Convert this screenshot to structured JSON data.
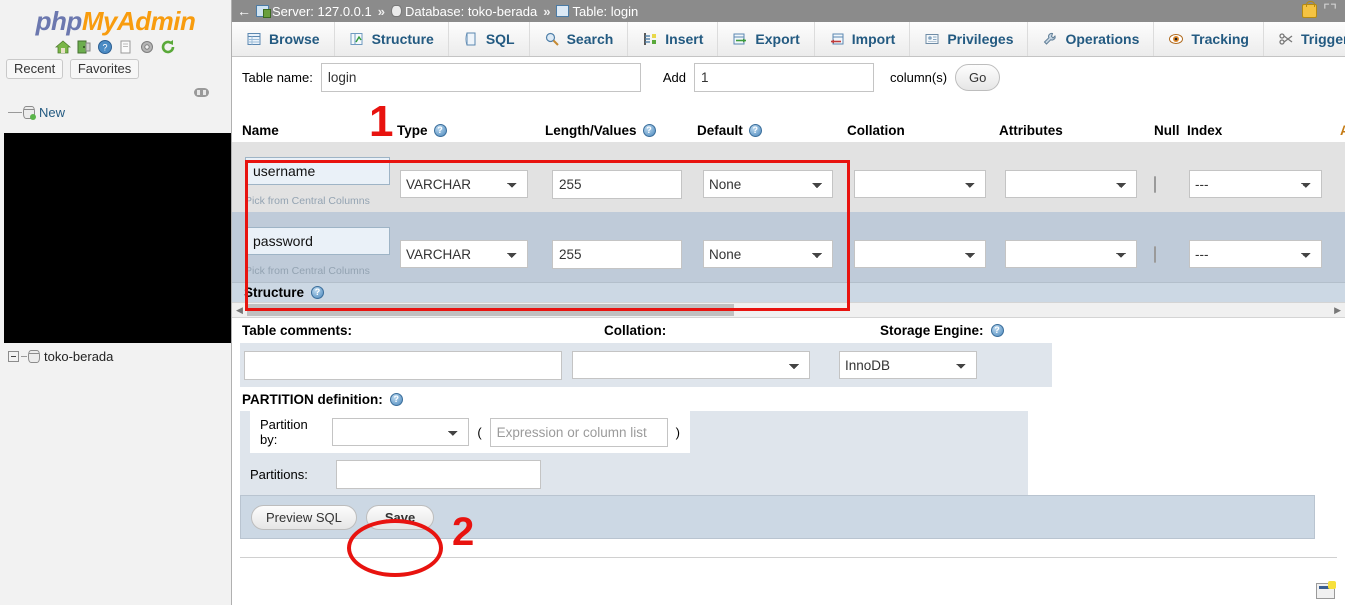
{
  "sidebar": {
    "logo": {
      "php": "php",
      "myadmin": "MyAdmin"
    },
    "logo_icons": [
      "home-icon",
      "logout-icon",
      "help-icon",
      "docs-icon",
      "settings-icon",
      "reload-icon"
    ],
    "nav_buttons": [
      {
        "label": "Recent",
        "name": "recent-button"
      },
      {
        "label": "Favorites",
        "name": "favorites-button"
      }
    ],
    "tree": {
      "new_label": "New",
      "database_label": "toko-berada"
    }
  },
  "topbar": {
    "back": "←",
    "breadcrumbs": [
      {
        "icon": "server-icon",
        "label": "Server: 127.0.0.1"
      },
      {
        "icon": "database-icon",
        "label": "Database: toko-berada"
      },
      {
        "icon": "table-icon",
        "label": "Table: login"
      }
    ],
    "separator": "»",
    "lock_icon": "lock-icon",
    "collapse_icon": "collapse-icon"
  },
  "tabs": [
    {
      "label": "Browse",
      "icon": "browse-icon"
    },
    {
      "label": "Structure",
      "icon": "structure-icon"
    },
    {
      "label": "SQL",
      "icon": "sql-icon"
    },
    {
      "label": "Search",
      "icon": "search-icon"
    },
    {
      "label": "Insert",
      "icon": "insert-icon"
    },
    {
      "label": "Export",
      "icon": "export-icon"
    },
    {
      "label": "Import",
      "icon": "import-icon"
    },
    {
      "label": "Privileges",
      "icon": "privileges-icon"
    },
    {
      "label": "Operations",
      "icon": "operations-icon"
    },
    {
      "label": "Tracking",
      "icon": "tracking-icon"
    },
    {
      "label": "Triggers",
      "icon": "triggers-icon"
    }
  ],
  "table_form": {
    "table_name_label": "Table name:",
    "table_name_value": "login",
    "add_label": "Add",
    "add_value": "1",
    "columns_label": "column(s)",
    "go_label": "Go"
  },
  "column_headers": {
    "name": "Name",
    "type": "Type",
    "length": "Length/Values",
    "default": "Default",
    "collation": "Collation",
    "attributes": "Attributes",
    "null": "Null",
    "index": "Index",
    "ai_partial": "A"
  },
  "fields": [
    {
      "name_value": "username",
      "pick_label": "Pick from Central Columns",
      "type_value": "VARCHAR",
      "length_value": "255",
      "default_value": "None",
      "collation_value": "",
      "attributes_value": "",
      "null_checked": false,
      "index_value": "---"
    },
    {
      "name_value": "password",
      "pick_label": "Pick from Central Columns",
      "type_value": "VARCHAR",
      "length_value": "255",
      "default_value": "None",
      "collation_value": "",
      "attributes_value": "",
      "null_checked": false,
      "index_value": "---"
    }
  ],
  "structure": {
    "title": "Structure",
    "table_comments_label": "Table comments:",
    "table_comments_value": "",
    "collation_label": "Collation:",
    "collation_value": "",
    "storage_engine_label": "Storage Engine:",
    "storage_engine_value": "InnoDB"
  },
  "partition": {
    "title": "PARTITION definition:",
    "partition_by_label": "Partition by:",
    "partition_by_value": "",
    "paren_open": "(",
    "expression_placeholder": "Expression or column list",
    "expression_value": "",
    "paren_close": ")",
    "partitions_label": "Partitions:",
    "partitions_value": ""
  },
  "actions": {
    "preview_sql": "Preview SQL",
    "save": "Save"
  },
  "annotations": {
    "step1": "1",
    "step2": "2",
    "accent_color": "#e8130f"
  },
  "footer": {
    "console_icon": "console-icon"
  }
}
